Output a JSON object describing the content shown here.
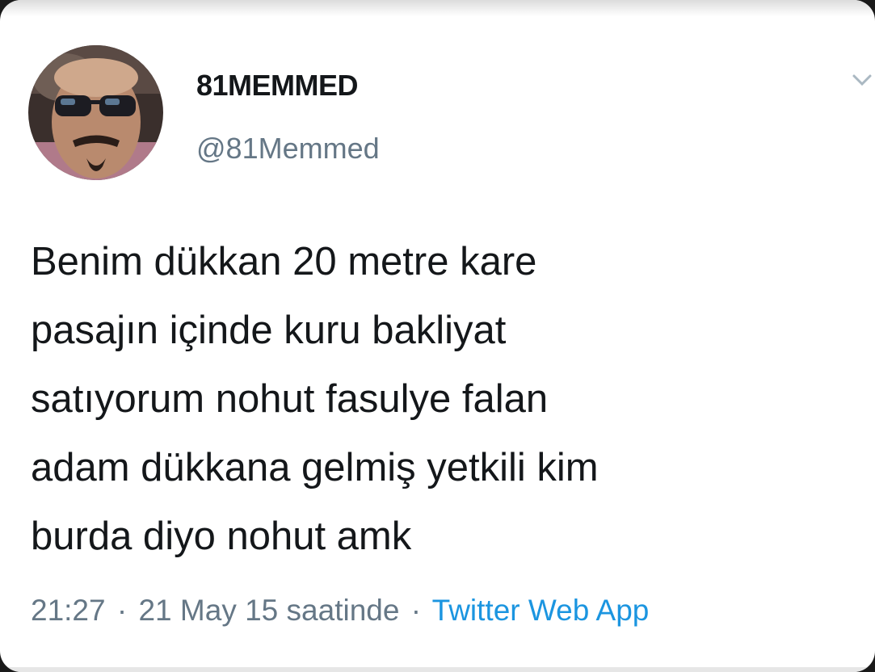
{
  "tweet": {
    "display_name": "81MEMMED",
    "handle": "@81Memmed",
    "avatar_icon": "profile-photo",
    "menu_icon": "chevron-down-icon",
    "text_lines": [
      "Benim dükkan 20 metre kare",
      "pasajın içinde kuru bakliyat",
      "satıyorum nohut fasulye falan",
      "adam dükkana gelmiş yetkili kim",
      "burda diyo nohut amk"
    ],
    "time": "21:27",
    "separator": "·",
    "date": "21 May 15 saatinde",
    "source": "Twitter Web App"
  },
  "colors": {
    "text": "#14171a",
    "secondary": "#657786",
    "link": "#1b95e0",
    "background": "#ffffff"
  }
}
